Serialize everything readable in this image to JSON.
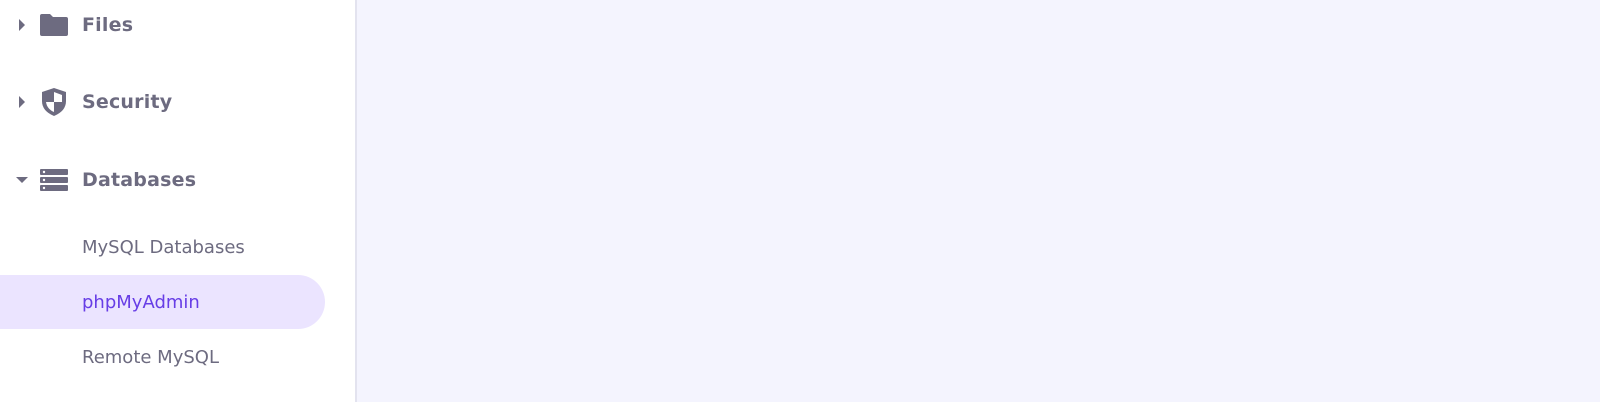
{
  "sidebar": {
    "groups": [
      {
        "label": "Files",
        "icon": "folder-icon",
        "expanded": false
      },
      {
        "label": "Security",
        "icon": "shield-icon",
        "expanded": false
      },
      {
        "label": "Databases",
        "icon": "database-icon",
        "expanded": true
      }
    ],
    "database_items": [
      {
        "label": "MySQL Databases",
        "active": false
      },
      {
        "label": "phpMyAdmin",
        "active": true
      },
      {
        "label": "Remote MySQL",
        "active": false
      }
    ]
  },
  "colors": {
    "text_muted": "#6d6b80",
    "accent": "#673de6",
    "active_bg": "#ebe4ff",
    "main_bg": "#f4f4fe"
  }
}
